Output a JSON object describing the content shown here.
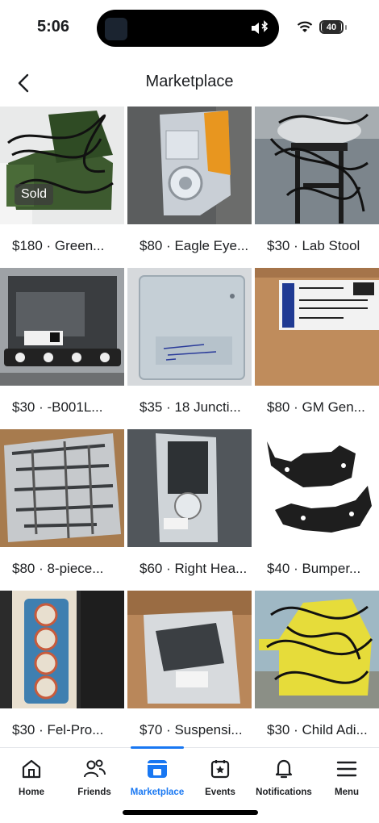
{
  "status_bar": {
    "time": "5:06",
    "battery": "40"
  },
  "header": {
    "title": "Marketplace",
    "back_icon": "chevron-left-icon"
  },
  "listings": [
    {
      "caption": "$180 · Green...",
      "badge": "Sold",
      "thumb": "green-recliner-scribbled"
    },
    {
      "caption": "$80 · Eagle Eye...",
      "thumb": "headlight-amber"
    },
    {
      "caption": "$30 · Lab Stool",
      "thumb": "stool-scribbled"
    },
    {
      "caption": "$30 · -B001L...",
      "thumb": "tail-light-assembly"
    },
    {
      "caption": "$35 · 18 Juncti...",
      "thumb": "junction-box-cover"
    },
    {
      "caption": "$80 · GM Gen...",
      "thumb": "gm-parts-box"
    },
    {
      "caption": "$80 · 8-piece...",
      "thumb": "bagged-parts"
    },
    {
      "caption": "$60 · Right Hea...",
      "thumb": "headlight-bagged"
    },
    {
      "caption": "$40 · Bumper...",
      "thumb": "bumper-brackets"
    },
    {
      "caption": "$30 · Fel-Pro...",
      "thumb": "head-gasket"
    },
    {
      "caption": "$70 · Suspensi...",
      "thumb": "bagged-suspension"
    },
    {
      "caption": "$30 · Child Adi...",
      "thumb": "yellow-chair-scribbled"
    }
  ],
  "bottom_nav": [
    {
      "label": "Home",
      "icon": "home-icon",
      "active": false
    },
    {
      "label": "Friends",
      "icon": "friends-icon",
      "active": false
    },
    {
      "label": "Marketplace",
      "icon": "marketplace-icon",
      "active": true
    },
    {
      "label": "Events",
      "icon": "events-icon",
      "active": false
    },
    {
      "label": "Notifications",
      "icon": "bell-icon",
      "active": false
    },
    {
      "label": "Menu",
      "icon": "menu-icon",
      "active": false
    }
  ],
  "colors": {
    "accent": "#1877f2",
    "text": "#1c1e21"
  }
}
